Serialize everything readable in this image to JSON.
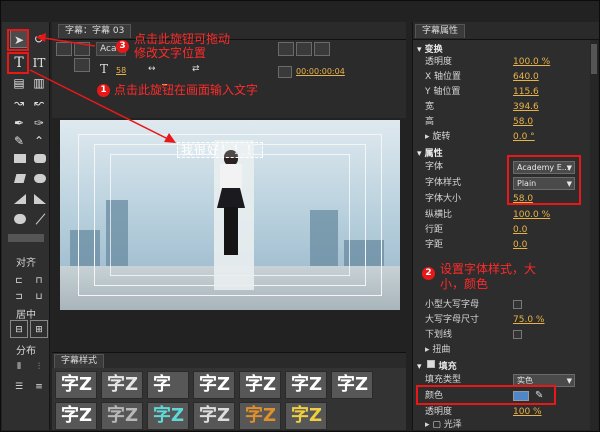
{
  "center": {
    "tab_label": "字幕：字幕 03",
    "font_field": "Academy",
    "size_value": "58",
    "timecode": "00:00:00:04",
    "caption_text": "我很好！！！"
  },
  "tools_panel": {
    "align_label": "对齐",
    "center_label": "居中",
    "distribute_label": "分布"
  },
  "styles_panel": {
    "tab_label": "字幕样式",
    "swatches": [
      {
        "glyph": "字Z",
        "color": "#ffffff"
      },
      {
        "glyph": "字Z",
        "color": "#e6e6e6"
      },
      {
        "glyph": "字",
        "color": "#ffffff"
      },
      {
        "glyph": "字Z",
        "color": "#ffffff"
      },
      {
        "glyph": "字Z",
        "color": "#ffffff"
      },
      {
        "glyph": "字Z",
        "color": "#ffffff"
      },
      {
        "glyph": "字Z",
        "color": "#ffffff"
      },
      {
        "glyph": "字Z",
        "color": "#ffffff"
      },
      {
        "glyph": "字Z",
        "color": "#b8b8b8"
      },
      {
        "glyph": "字Z",
        "color": "#5fd8d8"
      },
      {
        "glyph": "字Z",
        "color": "#dddddd"
      },
      {
        "glyph": "字Z",
        "color": "#e0902a"
      },
      {
        "glyph": "字Z",
        "color": "#f0d040"
      }
    ]
  },
  "properties": {
    "panel_title": "字幕属性",
    "transform_header": "变换",
    "opacity_label": "透明度",
    "opacity_value": "100.0 %",
    "x_label": "X 轴位置",
    "x_value": "640.0",
    "y_label": "Y 轴位置",
    "y_value": "115.6",
    "width_label": "宽",
    "width_value": "394.6",
    "height_label": "高",
    "height_value": "58.0",
    "rotation_label": "旋转",
    "rotation_value": "0.0 °",
    "attributes_header": "属性",
    "font_label": "字体",
    "font_value": "Academy E...",
    "font_style_label": "字体样式",
    "font_style_value": "Plain",
    "font_size_label": "字体大小",
    "font_size_value": "58.0",
    "aspect_label": "纵横比",
    "aspect_value": "100.0 %",
    "leading_label": "行距",
    "leading_value": "0.0",
    "kerning_label": "字距",
    "kerning_value": "0.0",
    "small_caps_label": "小型大写字母",
    "small_caps_size_label": "大写字母尺寸",
    "small_caps_size_value": "75.0 %",
    "underline_label": "下划线",
    "distort_label": "扭曲",
    "fill_header": "填充",
    "fill_type_label": "填充类型",
    "fill_type_value": "实色",
    "color_label": "颜色",
    "color_value": "#4f86c8",
    "fill_opacity_label": "透明度",
    "fill_opacity_value": "100 %",
    "sheen_label": "光泽"
  },
  "annotations": {
    "a1_num": "1",
    "a1_text": "点击此旋钮在画面输入文字",
    "a2_num": "2",
    "a2_line1": "设置字体样式，大",
    "a2_line2": "小，颜色",
    "a3_num": "3",
    "a3_line1": "点击此旋钮可拖动",
    "a3_line2": "修改文字位置",
    "color": "#e81818"
  }
}
